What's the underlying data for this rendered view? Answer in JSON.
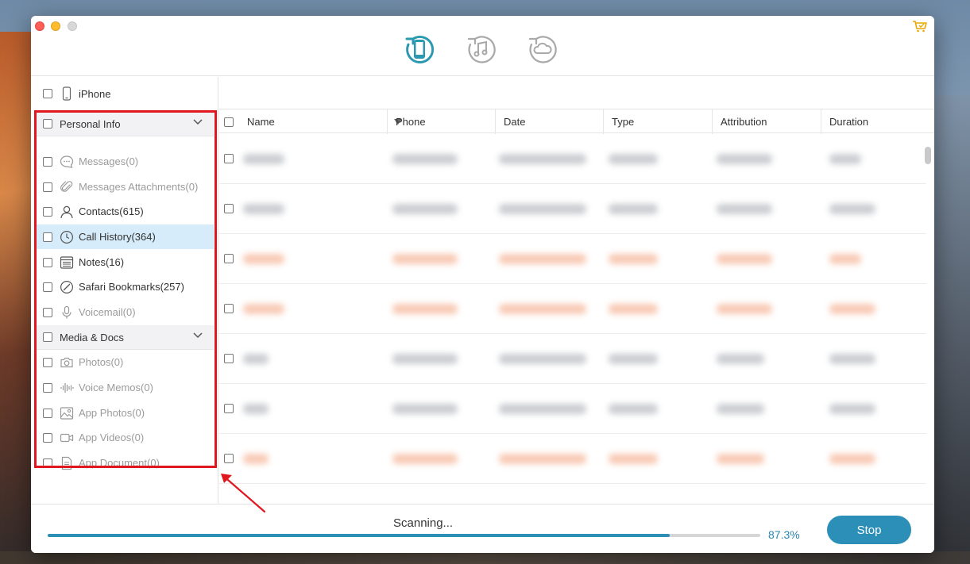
{
  "device": {
    "label": "iPhone"
  },
  "sidebar": {
    "sections": [
      {
        "title": "Personal Info"
      },
      {
        "title": "Media & Docs"
      }
    ],
    "items": [
      {
        "label": "Messages(0)",
        "icon": "message-icon",
        "enabled": false
      },
      {
        "label": "Messages Attachments(0)",
        "icon": "paperclip-icon",
        "enabled": false
      },
      {
        "label": "Contacts(615)",
        "icon": "contacts-icon",
        "enabled": true
      },
      {
        "label": "Call History(364)",
        "icon": "clock-icon",
        "enabled": true,
        "selected": true
      },
      {
        "label": "Notes(16)",
        "icon": "notes-icon",
        "enabled": true
      },
      {
        "label": "Safari Bookmarks(257)",
        "icon": "compass-icon",
        "enabled": true
      },
      {
        "label": "Voicemail(0)",
        "icon": "microphone-icon",
        "enabled": false
      },
      {
        "label": "Photos(0)",
        "icon": "camera-icon",
        "enabled": false
      },
      {
        "label": "Voice Memos(0)",
        "icon": "waveform-icon",
        "enabled": false
      },
      {
        "label": "App Photos(0)",
        "icon": "image-icon",
        "enabled": false
      },
      {
        "label": "App Videos(0)",
        "icon": "video-icon",
        "enabled": false
      },
      {
        "label": "App Document(0)",
        "icon": "document-icon",
        "enabled": false
      }
    ]
  },
  "table": {
    "columns": [
      "Name",
      "Phone",
      "Date",
      "Type",
      "Attribution",
      "Duration"
    ]
  },
  "footer": {
    "status": "Scanning...",
    "progress_label": "87.3%",
    "progress_value": 0.873,
    "stop_label": "Stop"
  },
  "colors": {
    "accent": "#2b8fb8",
    "highlight": "#e0171f",
    "selected_row": "#d6ecfa"
  }
}
